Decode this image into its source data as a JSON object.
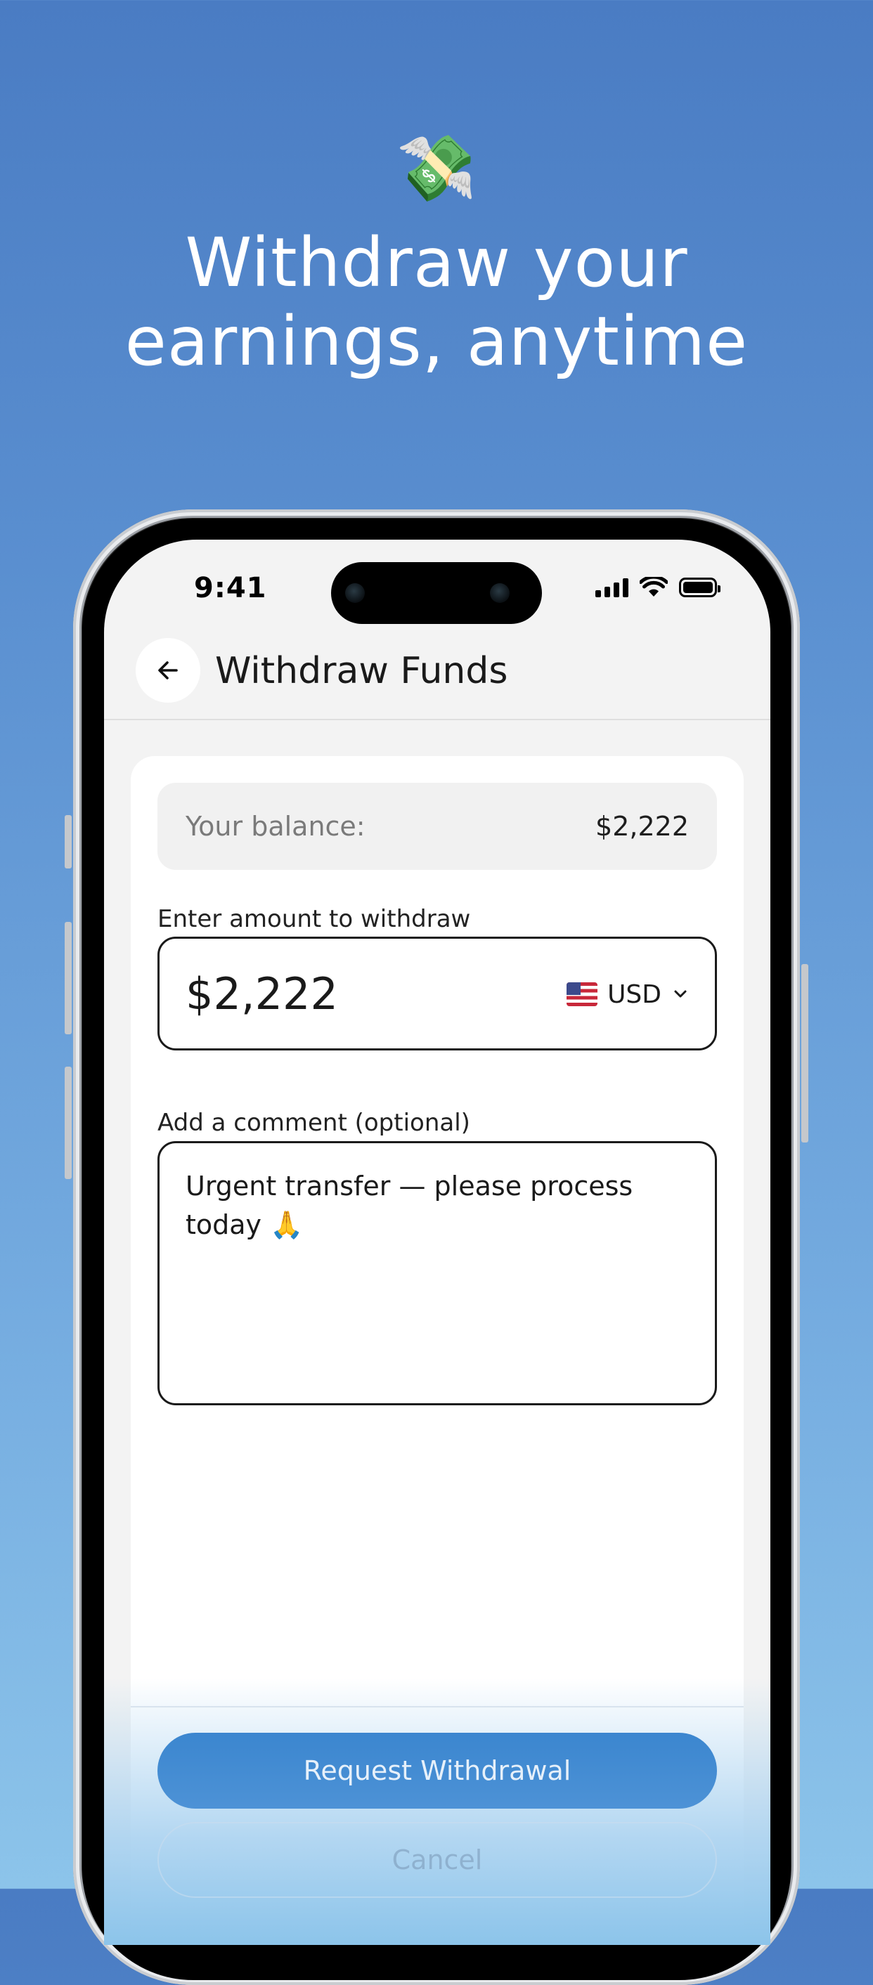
{
  "hero": {
    "emoji": "💸",
    "title_line1": "Withdraw your",
    "title_line2": "earnings, anytime"
  },
  "status_bar": {
    "time": "9:41"
  },
  "header": {
    "back_icon": "arrow-left-icon",
    "title": "Withdraw Funds"
  },
  "balance": {
    "label": "Your balance:",
    "value": "$2,222"
  },
  "amount": {
    "label": "Enter amount to withdraw",
    "value": "$2,222",
    "currency": "USD",
    "currency_flag": "us-flag-icon"
  },
  "comment": {
    "label": "Add a comment (optional)",
    "value": "Urgent transfer — please process today 🙏"
  },
  "actions": {
    "primary": "Request Withdrawal",
    "secondary": "Cancel"
  },
  "colors": {
    "background_top": "#4a7cc3",
    "background_bottom": "#8cc4ea",
    "primary_button": "#3b86cf"
  }
}
